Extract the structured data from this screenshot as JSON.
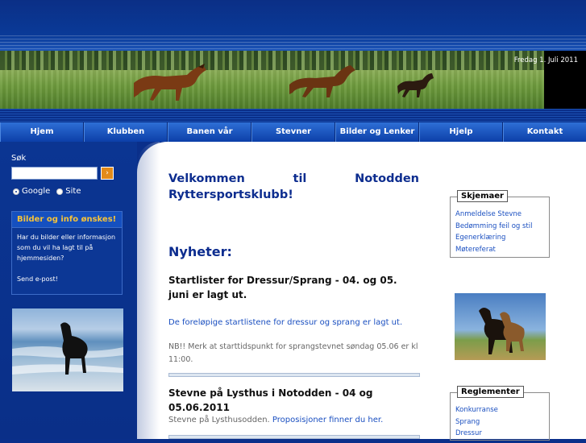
{
  "header": {
    "date": "Fredag 1. Juli 2011"
  },
  "nav": {
    "items": [
      "Hjem",
      "Klubben",
      "Banen vår",
      "Stevner",
      "Bilder og Lenker",
      "Hjelp",
      "Kontakt"
    ]
  },
  "search": {
    "label": "Søk",
    "placeholder": "",
    "button_glyph": "›",
    "options": [
      "Google",
      "Site"
    ]
  },
  "infobox": {
    "title": "Bilder og info ønskes!",
    "body": "Har du bilder eller informasjon som du vil ha lagt til på hjemmesiden?",
    "link": "Send e-post!"
  },
  "main": {
    "welcome_words": [
      "Velkommen",
      "til",
      "Notodden"
    ],
    "welcome_line2": "Ryttersportsklubb!",
    "news_heading": "Nyheter:",
    "news": [
      {
        "title": "Startlister for Dressur/Sprang - 04. og 05. juni er lagt ut.",
        "link": "De foreløpige startlistene for dressur og sprang er lagt ut.",
        "note": "NB!! Merk at starttidspunkt for sprangstevnet søndag 05.06 er kl 11:00."
      },
      {
        "title": "Stevne på Lysthus i Notodden - 04 og 05.06.2011",
        "text": "Stevne på Lysthusodden. ",
        "link": "Proposisjoner finner du her."
      }
    ]
  },
  "skjemaer": {
    "title": "Skjemaer",
    "links": [
      "Anmeldelse Stevne",
      "Bedømming feil og stil",
      "Egenerklæring",
      "Møtereferat"
    ]
  },
  "reglementer": {
    "title": "Reglementer",
    "links": [
      "Konkurranse",
      "Sprang",
      "Dressur"
    ]
  }
}
